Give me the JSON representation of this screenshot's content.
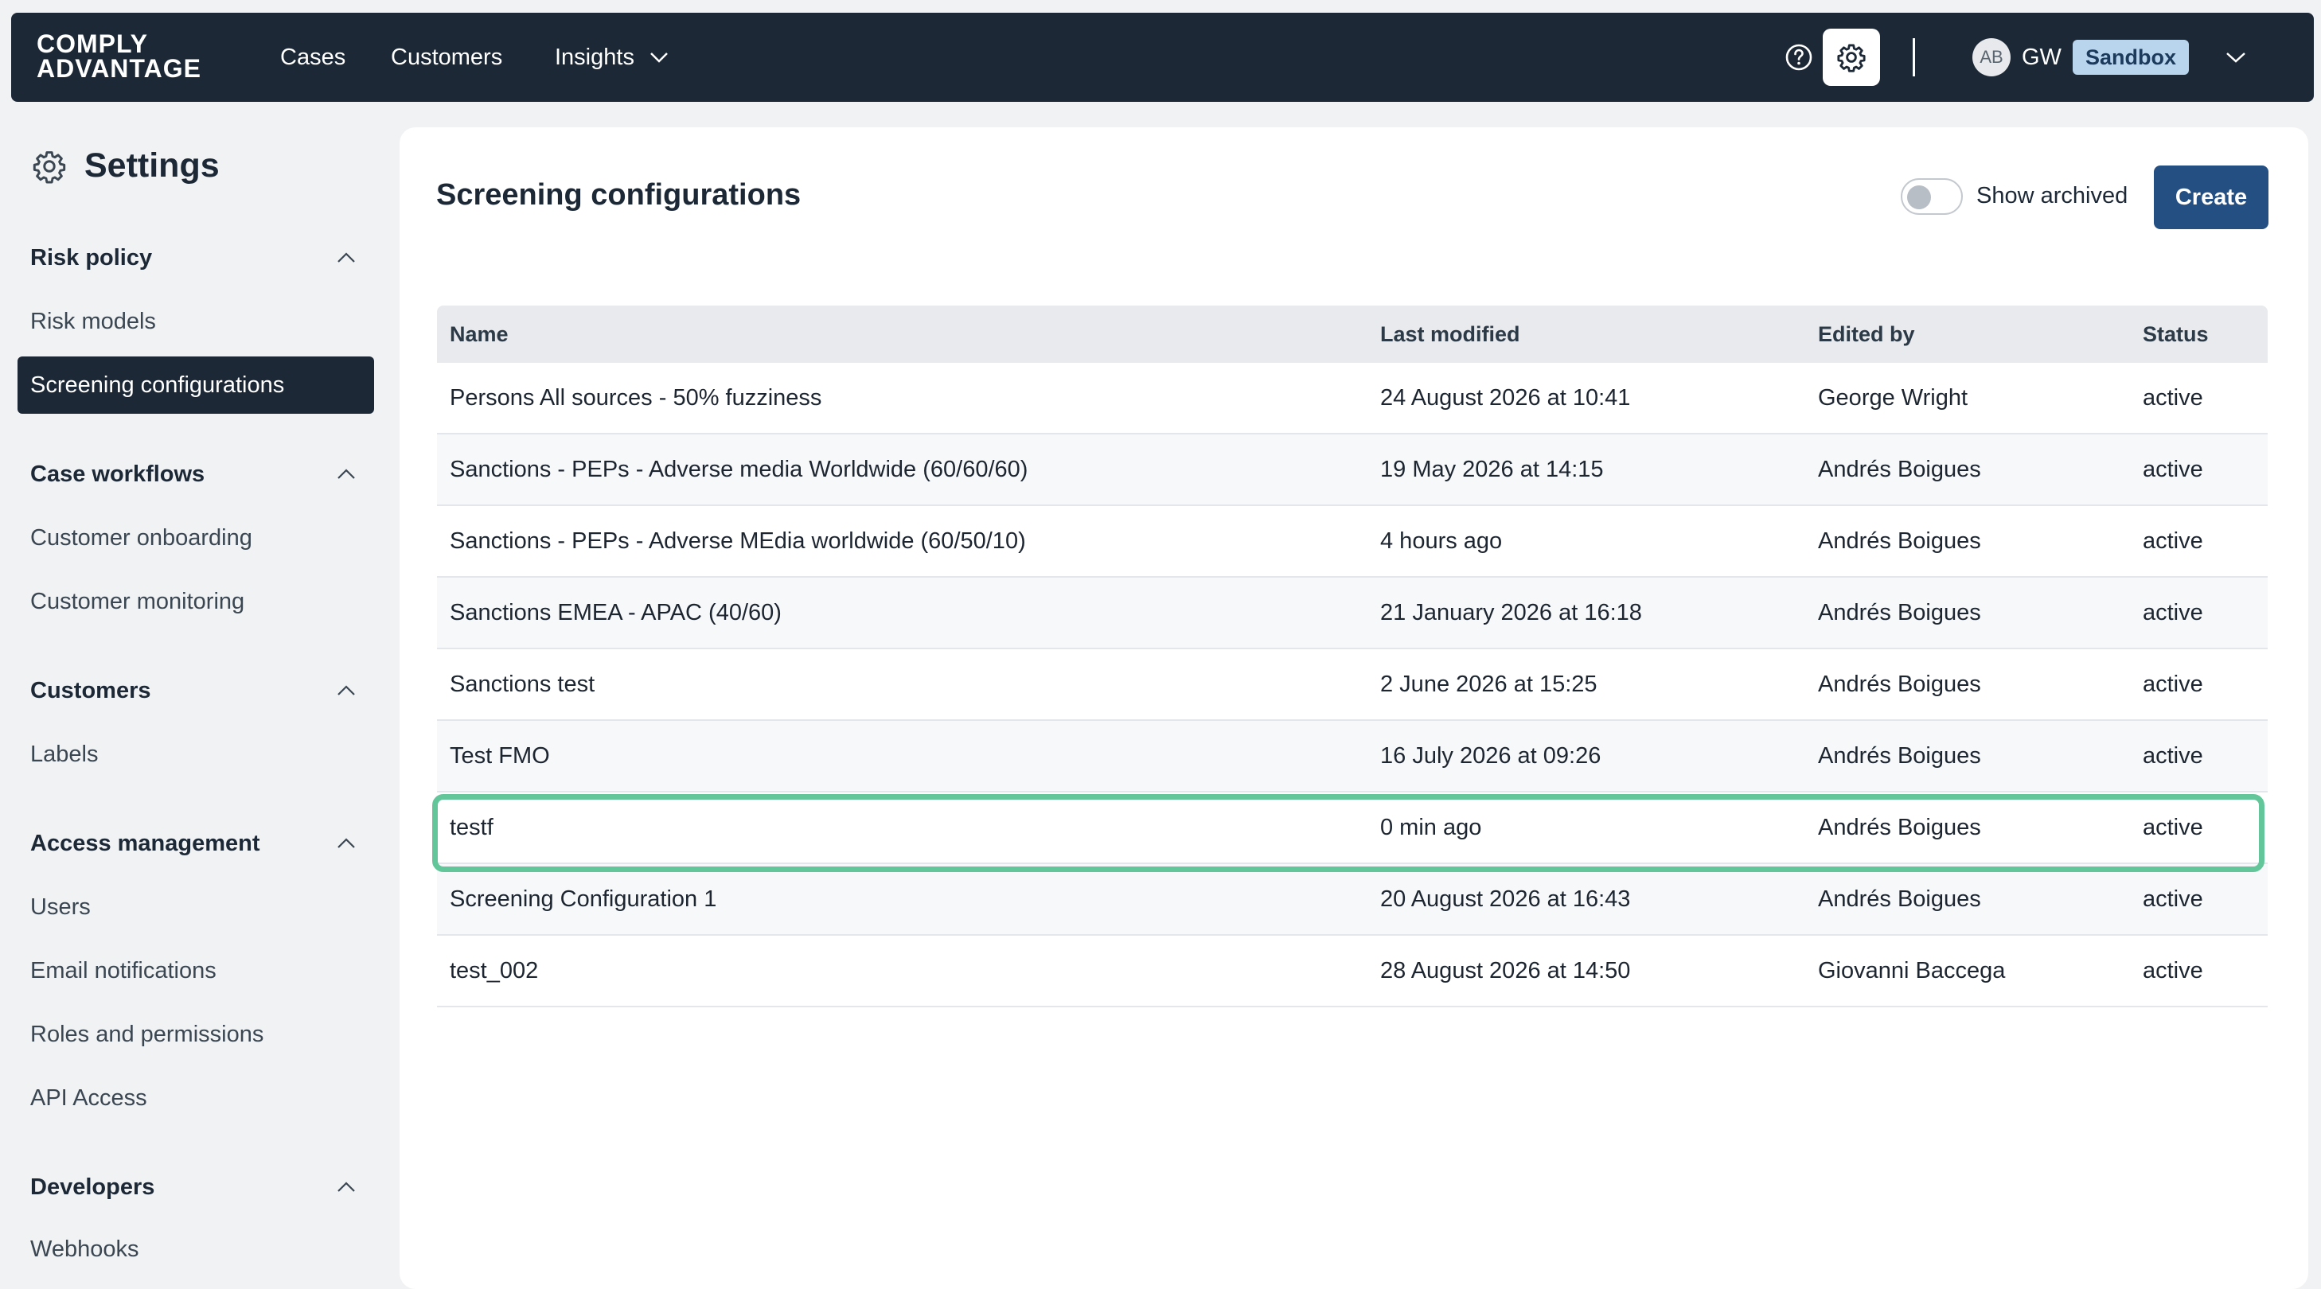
{
  "brand": {
    "line1": "COMPLY",
    "line2": "ADVANTAGE"
  },
  "topnav": {
    "items": [
      {
        "label": "Cases"
      },
      {
        "label": "Customers"
      },
      {
        "label": "Insights"
      }
    ],
    "help_icon": "question-circle-icon",
    "settings_icon": "gear-icon",
    "avatar_initials": "AB",
    "user_initials": "GW",
    "environment": "Sandbox"
  },
  "sidebar": {
    "title": "Settings",
    "sections": [
      {
        "label": "Risk policy",
        "items": [
          "Risk models",
          "Screening configurations"
        ]
      },
      {
        "label": "Case workflows",
        "items": [
          "Customer onboarding",
          "Customer monitoring"
        ]
      },
      {
        "label": "Customers",
        "items": [
          "Labels"
        ]
      },
      {
        "label": "Access management",
        "items": [
          "Users",
          "Email notifications",
          "Roles and permissions",
          "API Access"
        ]
      },
      {
        "label": "Developers",
        "items": [
          "Webhooks"
        ]
      }
    ],
    "active_item": "Screening configurations"
  },
  "main": {
    "heading": "Screening configurations",
    "show_archived_label": "Show archived",
    "show_archived_on": false,
    "create_label": "Create",
    "table": {
      "columns": [
        "Name",
        "Last modified",
        "Edited by",
        "Status"
      ],
      "rows": [
        [
          "Persons All sources - 50% fuzziness",
          "24 August 2026 at 10:41",
          "George Wright",
          "active"
        ],
        [
          "Sanctions - PEPs - Adverse media Worldwide (60/60/60)",
          "19 May 2026 at 14:15",
          "Andrés Boigues",
          "active"
        ],
        [
          "Sanctions - PEPs - Adverse MEdia worldwide (60/50/10)",
          "4 hours ago",
          "Andrés Boigues",
          "active"
        ],
        [
          "Sanctions EMEA - APAC (40/60)",
          "21 January 2026 at 16:18",
          "Andrés Boigues",
          "active"
        ],
        [
          "Sanctions test",
          "2 June 2026 at 15:25",
          "Andrés Boigues",
          "active"
        ],
        [
          "Test FMO",
          "16 July 2026 at 09:26",
          "Andrés Boigues",
          "active"
        ],
        [
          "testf",
          "0 min ago",
          "Andrés Boigues",
          "active"
        ],
        [
          "Screening Configuration 1",
          "20 August 2026 at 16:43",
          "Andrés Boigues",
          "active"
        ],
        [
          "test_002",
          "28 August 2026 at 14:50",
          "Giovanni Baccega",
          "active"
        ]
      ],
      "highlighted_row": "testf"
    }
  },
  "colors": {
    "nav_bg": "#1c2836",
    "primary": "#234f82",
    "highlight": "#63c69a",
    "badge_bg": "#b9d5ee"
  }
}
